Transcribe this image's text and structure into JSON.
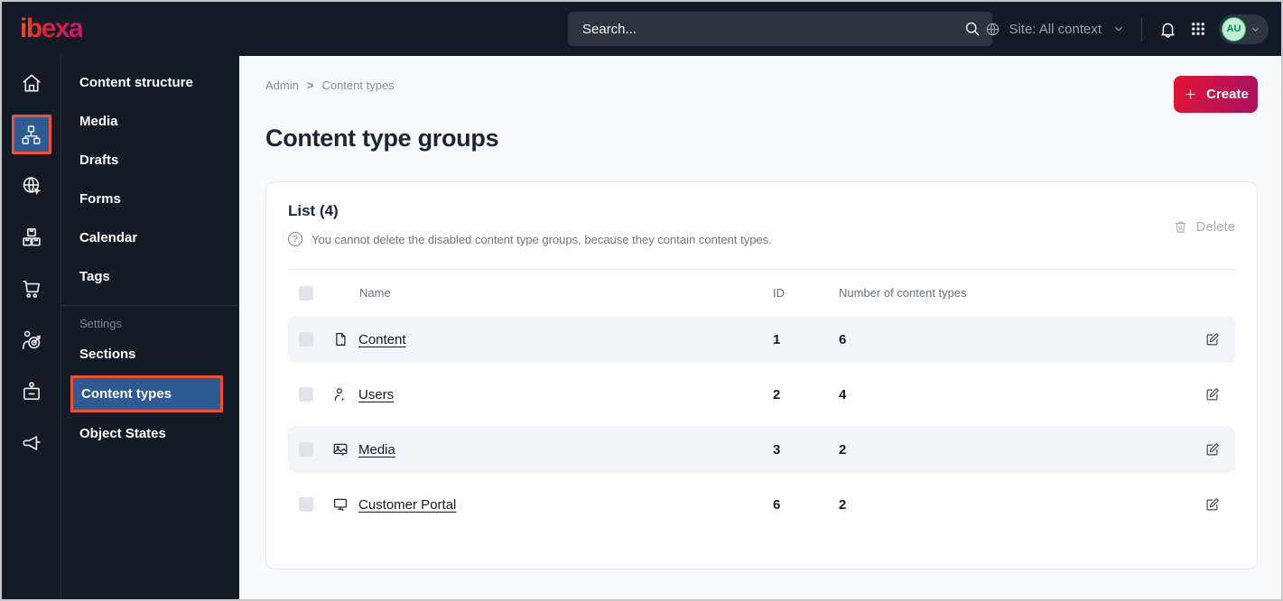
{
  "topbar": {
    "logo_text": "ibexa",
    "search_placeholder": "Search...",
    "site_context_label": "Site: All context",
    "avatar_initials": "AU"
  },
  "icon_rail": {
    "items": [
      {
        "icon": "home-icon",
        "active": false
      },
      {
        "icon": "content-structure-icon",
        "active": true
      },
      {
        "icon": "site-globe-icon",
        "active": false
      },
      {
        "icon": "product-boxes-icon",
        "active": false
      },
      {
        "icon": "commerce-cart-icon",
        "active": false
      },
      {
        "icon": "audience-target-icon",
        "active": false
      },
      {
        "icon": "badge-icon",
        "active": false
      },
      {
        "icon": "megaphone-icon",
        "active": false
      }
    ]
  },
  "sidebar": {
    "items": [
      "Content structure",
      "Media",
      "Drafts",
      "Forms",
      "Calendar",
      "Tags"
    ],
    "settings_heading": "Settings",
    "settings_items": [
      "Sections",
      "Content types",
      "Object States"
    ],
    "active_item": "Content types"
  },
  "main": {
    "breadcrumb": {
      "items": [
        "Admin",
        "Content types"
      ],
      "separator": ">"
    },
    "create_button": "Create",
    "page_title": "Content type groups",
    "list_card": {
      "title": "List (4)",
      "info_text": "You cannot delete the disabled content type groups, because they contain content types.",
      "delete_button": "Delete",
      "columns": {
        "name": "Name",
        "id": "ID",
        "count": "Number of content types"
      },
      "rows": [
        {
          "icon": "content-file-icon",
          "name": "Content",
          "id": "1",
          "count": "6"
        },
        {
          "icon": "users-icon",
          "name": "Users",
          "id": "2",
          "count": "4"
        },
        {
          "icon": "media-image-icon",
          "name": "Media",
          "id": "3",
          "count": "2"
        },
        {
          "icon": "customer-portal-monitor-icon",
          "name": "Customer Portal",
          "id": "6",
          "count": "2"
        }
      ]
    }
  },
  "colors": {
    "topbar_bg": "#131c26",
    "accent_orange": "#f4502e",
    "active_blue": "#2d5a92",
    "create_gradient_start": "#e01436",
    "create_gradient_end": "#a8125f",
    "avatar_green": "#2fbe78",
    "row_stripe": "#f4f5f8"
  }
}
